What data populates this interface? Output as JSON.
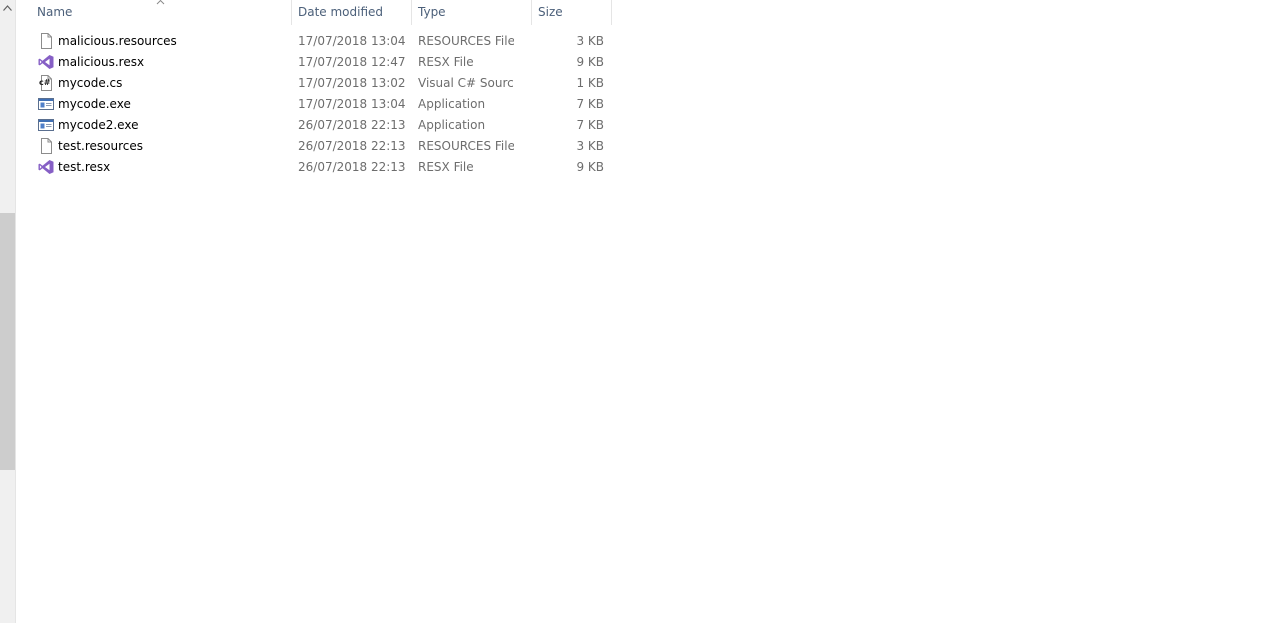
{
  "columns": {
    "name": "Name",
    "date": "Date modified",
    "type": "Type",
    "size": "Size"
  },
  "files": [
    {
      "name": "malicious.resources",
      "date": "17/07/2018 13:04",
      "type": "RESOURCES File",
      "size": "3 KB",
      "icon": "blank-file-icon"
    },
    {
      "name": "malicious.resx",
      "date": "17/07/2018 12:47",
      "type": "RESX File",
      "size": "9 KB",
      "icon": "visual-studio-icon"
    },
    {
      "name": "mycode.cs",
      "date": "17/07/2018 13:02",
      "type": "Visual C# Source f",
      "size": "1 KB",
      "icon": "csharp-file-icon"
    },
    {
      "name": "mycode.exe",
      "date": "17/07/2018 13:04",
      "type": "Application",
      "size": "7 KB",
      "icon": "application-icon"
    },
    {
      "name": "mycode2.exe",
      "date": "26/07/2018 22:13",
      "type": "Application",
      "size": "7 KB",
      "icon": "application-icon"
    },
    {
      "name": "test.resources",
      "date": "26/07/2018 22:13",
      "type": "RESOURCES File",
      "size": "3 KB",
      "icon": "blank-file-icon"
    },
    {
      "name": "test.resx",
      "date": "26/07/2018 22:13",
      "type": "RESX File",
      "size": "9 KB",
      "icon": "visual-studio-icon"
    }
  ],
  "colors": {
    "header_text": "#4c607a",
    "detail_text": "#6d6d6d",
    "vs_purple": "#865fc5",
    "scroll_thumb": "#cdcdcd"
  }
}
